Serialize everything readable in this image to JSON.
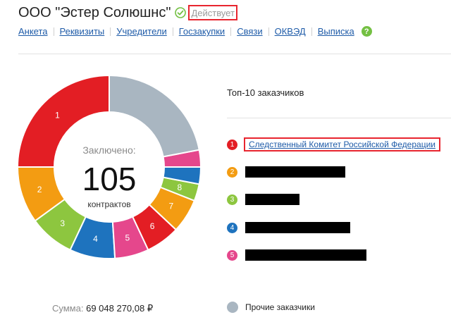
{
  "header": {
    "company": "ООО \"Эстер Солюшнс\"",
    "status": "Действует"
  },
  "nav": {
    "tabs": [
      "Анкета",
      "Реквизиты",
      "Учредители",
      "Госзакупки",
      "Связи",
      "ОКВЭД",
      "Выписка"
    ],
    "help": "?"
  },
  "chart_data": {
    "type": "pie",
    "center_caption": "Заключено:",
    "total": "105",
    "unit": "контрактов",
    "segments": [
      {
        "label": "1",
        "share": 25.0,
        "color": "#e31e24"
      },
      {
        "label": "2",
        "share": 10.0,
        "color": "#f39c12"
      },
      {
        "label": "3",
        "share": 8.0,
        "color": "#8dc63f"
      },
      {
        "label": "4",
        "share": 8.0,
        "color": "#1e73be"
      },
      {
        "label": "5",
        "share": 6.0,
        "color": "#e5478c"
      },
      {
        "label": "6",
        "share": 6.0,
        "color": "#e31e24"
      },
      {
        "label": "7",
        "share": 6.0,
        "color": "#f39c12"
      },
      {
        "label": "8",
        "share": 3.0,
        "color": "#8dc63f"
      },
      {
        "label": "",
        "share": 3.0,
        "color": "#1e73be"
      },
      {
        "label": "",
        "share": 3.0,
        "color": "#e5478c"
      },
      {
        "label": "",
        "share": 22.0,
        "color": "#a9b6c1"
      }
    ]
  },
  "summary": {
    "label": "Сумма:",
    "value": "69 048 270,08 ₽"
  },
  "top": {
    "title": "Топ-10 заказчиков",
    "customers": [
      {
        "num": "1",
        "name": "Следственный Комитет Российской Федерации",
        "color": "#e31e24"
      },
      {
        "num": "2",
        "color": "#f39c12",
        "redacted": true
      },
      {
        "num": "3",
        "color": "#8dc63f",
        "redacted": true
      },
      {
        "num": "4",
        "color": "#1e73be",
        "redacted": true
      },
      {
        "num": "5",
        "color": "#e5478c",
        "redacted": true
      }
    ],
    "other": "Прочие заказчики"
  }
}
